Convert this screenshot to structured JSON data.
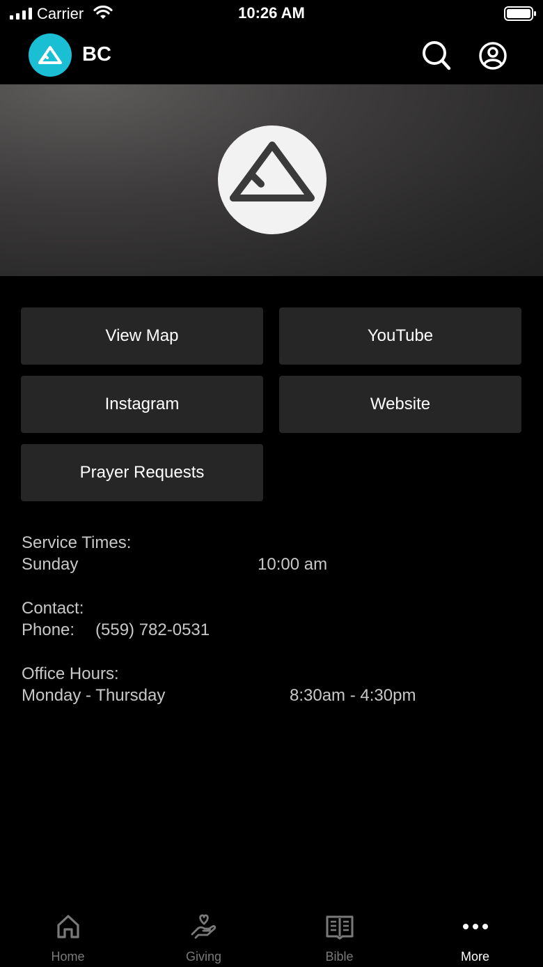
{
  "status_bar": {
    "carrier": "Carrier",
    "time": "10:26 AM",
    "icons": [
      "signal-icon",
      "wifi-icon",
      "battery-icon"
    ]
  },
  "header": {
    "app_name": "BC",
    "icons": [
      "logo-icon",
      "search-icon",
      "profile-icon"
    ],
    "accent_color": "#1bbfd3"
  },
  "buttons": {
    "view_map": "View Map",
    "youtube": "YouTube",
    "instagram": "Instagram",
    "website": "Website",
    "prayer_requests": "Prayer Requests"
  },
  "service_times": {
    "heading": "Service Times:",
    "day": "Sunday",
    "time": "10:00 am"
  },
  "contact": {
    "heading": "Contact:",
    "phone_label": "Phone:",
    "phone": "(559) 782-0531"
  },
  "office_hours": {
    "heading": "Office Hours:",
    "days": "Monday - Thursday",
    "hours": "8:30am - 4:30pm"
  },
  "tab_bar": {
    "tabs": [
      {
        "label": "Home",
        "icon": "home-icon"
      },
      {
        "label": "Giving",
        "icon": "giving-icon"
      },
      {
        "label": "Bible",
        "icon": "bible-icon"
      },
      {
        "label": "More",
        "icon": "more-icon",
        "active": true
      }
    ]
  }
}
